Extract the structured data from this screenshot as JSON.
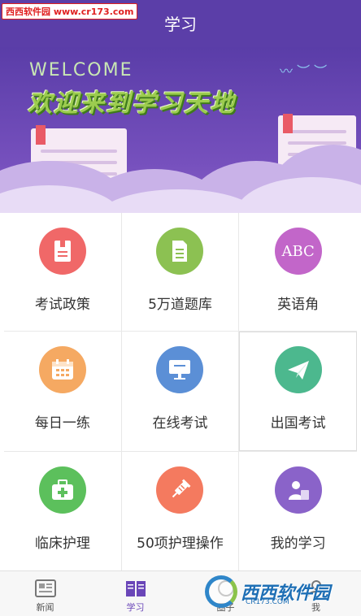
{
  "watermark": {
    "text": "西西软件园 www.cr173.com"
  },
  "header": {
    "title": "学习"
  },
  "banner": {
    "welcome": "WELCOME",
    "title": "欢迎来到学习天地"
  },
  "grid": {
    "items": [
      {
        "label": "考试政策",
        "icon": "document-icon",
        "color": "#f06868"
      },
      {
        "label": "5万道题库",
        "icon": "file-icon",
        "color": "#8cc152"
      },
      {
        "label": "英语角",
        "icon": "abc-icon",
        "icon_text": "ABC",
        "color": "#c266c9"
      },
      {
        "label": "每日一练",
        "icon": "calendar-icon",
        "color": "#f5a962"
      },
      {
        "label": "在线考试",
        "icon": "monitor-icon",
        "color": "#5b8fd6"
      },
      {
        "label": "出国考试",
        "icon": "paper-plane-icon",
        "color": "#4cb88e"
      },
      {
        "label": "临床护理",
        "icon": "medical-kit-icon",
        "color": "#5cc05c"
      },
      {
        "label": "50项护理操作",
        "icon": "syringe-icon",
        "color": "#f47a5f"
      },
      {
        "label": "我的学习",
        "icon": "user-book-icon",
        "color": "#8a63c9"
      }
    ]
  },
  "tabbar": {
    "items": [
      {
        "label": "新闻",
        "icon": "news-icon"
      },
      {
        "label": "学习",
        "icon": "book-icon",
        "active": true
      },
      {
        "label": "圈子",
        "icon": "circle-icon"
      },
      {
        "label": "我",
        "icon": "me-icon"
      }
    ]
  },
  "logo_watermark": {
    "text": "西西软件园",
    "sub": "CR173.COM"
  },
  "colors": {
    "header": "#5b3ea8",
    "accent": "#6a46b8"
  }
}
